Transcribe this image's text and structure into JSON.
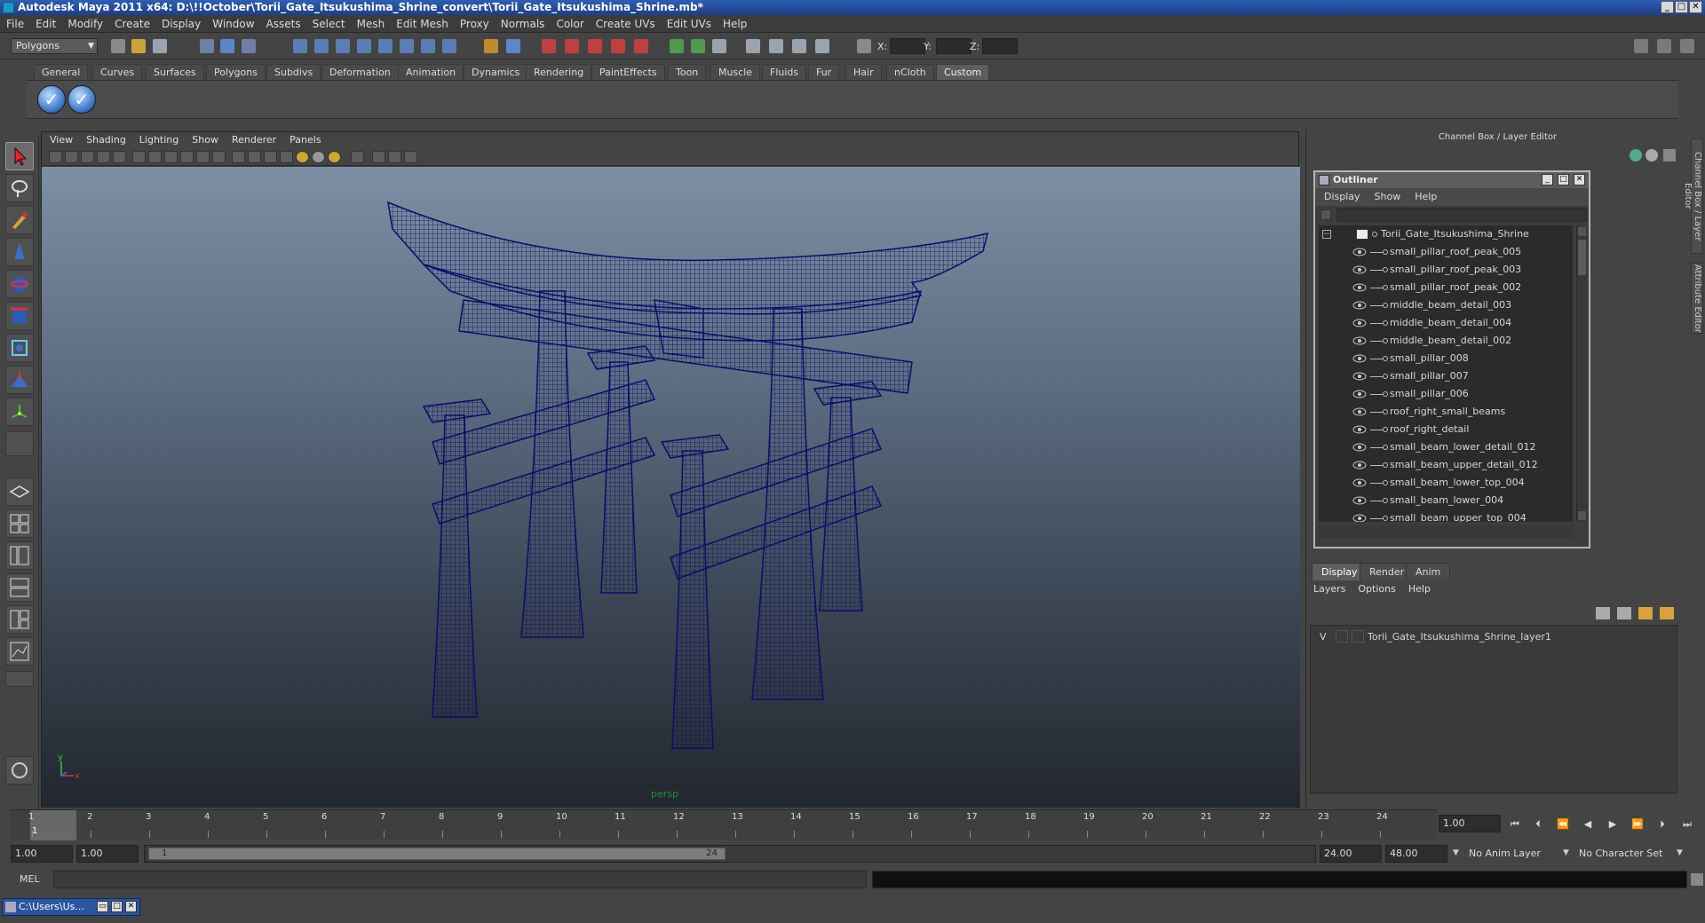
{
  "titlebar": {
    "title": "Autodesk Maya 2011 x64: D:\\!!October\\Torii_Gate_Itsukushima_Shrine_convert\\Torii_Gate_Itsukushima_Shrine.mb*",
    "minimize": "_",
    "maximize": "□",
    "close": "✕"
  },
  "menubar": [
    "File",
    "Edit",
    "Modify",
    "Create",
    "Display",
    "Window",
    "Assets",
    "Select",
    "Mesh",
    "Edit Mesh",
    "Proxy",
    "Normals",
    "Color",
    "Create UVs",
    "Edit UVs",
    "Help"
  ],
  "statusline": {
    "mode": "Polygons",
    "x_label": "X:",
    "y_label": "Y:",
    "z_label": "Z:"
  },
  "shelf": {
    "tabs": [
      "General",
      "Curves",
      "Surfaces",
      "Polygons",
      "Subdivs",
      "Deformation",
      "Animation",
      "Dynamics",
      "Rendering",
      "PaintEffects",
      "Toon",
      "Muscle",
      "Fluids",
      "Fur",
      "Hair",
      "nCloth",
      "Custom"
    ],
    "active_tab": "Custom",
    "buttons": [
      "✓",
      "✓"
    ]
  },
  "viewport": {
    "menu": [
      "View",
      "Shading",
      "Lighting",
      "Show",
      "Renderer",
      "Panels"
    ],
    "camera": "persp",
    "axis_y": "y",
    "axis_x": "x",
    "model_color": "#0b0d6a"
  },
  "right_panel": {
    "header": "Channel Box / Layer Editor",
    "side_tabs": [
      "Channel Box / Layer Editor",
      "Attribute Editor"
    ]
  },
  "outliner": {
    "title": "Outliner",
    "menu": [
      "Display",
      "Show",
      "Help"
    ],
    "root": "Torii_Gate_Itsukushima_Shrine",
    "items": [
      "small_pillar_roof_peak_005",
      "small_pillar_roof_peak_003",
      "small_pillar_roof_peak_002",
      "middle_beam_detail_003",
      "middle_beam_detail_004",
      "middle_beam_detail_002",
      "small_pillar_008",
      "small_pillar_007",
      "small_pillar_006",
      "roof_right_small_beams",
      "roof_right_detail",
      "small_beam_lower_detail_012",
      "small_beam_upper_detail_012",
      "small_beam_lower_top_004",
      "small_beam_lower_004",
      "small_beam_upper_top_004"
    ]
  },
  "layer_editor": {
    "tabs": [
      "Display",
      "Render",
      "Anim"
    ],
    "active_tab": "Display",
    "menu": [
      "Layers",
      "Options",
      "Help"
    ],
    "layer_visibility": "V",
    "layer_name": "Torii_Gate_Itsukushima_Shrine_layer1"
  },
  "timeline": {
    "ticks": [
      "1",
      "2",
      "3",
      "4",
      "5",
      "6",
      "7",
      "8",
      "9",
      "10",
      "11",
      "12",
      "13",
      "14",
      "15",
      "16",
      "17",
      "18",
      "19",
      "20",
      "21",
      "22",
      "23",
      "24"
    ],
    "current_frame": "1.00",
    "cursor_label": "1"
  },
  "range": {
    "start": "1.00",
    "playback_start": "1.00",
    "handle_start": "1",
    "handle_end": "24",
    "playback_end": "24.00",
    "end": "48.00",
    "anim_layer": "No Anim Layer",
    "character_set": "No Character Set"
  },
  "cmdline": {
    "label": "MEL"
  },
  "taskbar": {
    "window_title": "C:\\Users\\Us..."
  }
}
